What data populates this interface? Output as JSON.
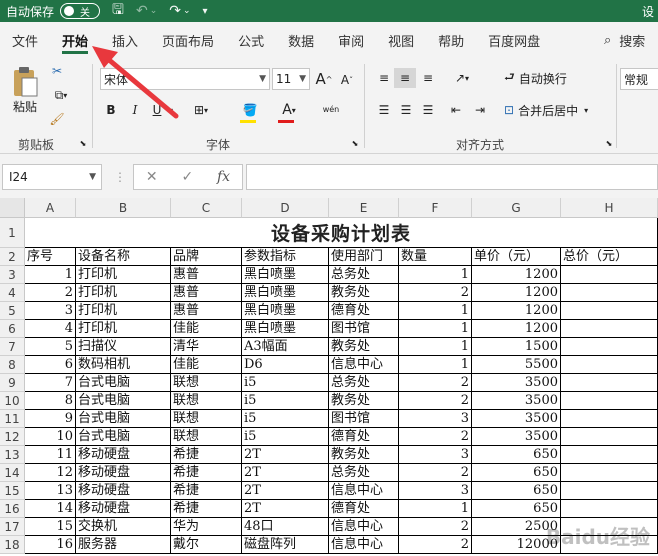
{
  "titlebar": {
    "autosave_label": "自动保存",
    "toggle_state": "关",
    "right_edge_text": "设"
  },
  "tabs": [
    "文件",
    "开始",
    "插入",
    "页面布局",
    "公式",
    "数据",
    "审阅",
    "视图",
    "帮助",
    "百度网盘"
  ],
  "active_tab": "开始",
  "search_label": "搜索",
  "ribbon": {
    "clipboard": {
      "paste_label": "粘贴",
      "group_label": "剪贴板"
    },
    "font": {
      "font_name": "宋体",
      "font_size": "11",
      "group_label": "字体",
      "bold": "B",
      "italic": "I",
      "underline": "U",
      "grow": "A",
      "shrink": "A",
      "font_color_letter": "A",
      "wen": "wén"
    },
    "alignment": {
      "wrap_text": "自动换行",
      "merge_center": "合并后居中",
      "group_label": "对齐方式"
    },
    "number": {
      "format": "常规"
    }
  },
  "formula_bar": {
    "name_box": "I24",
    "fx_label": "fx",
    "cancel": "✕",
    "enter": "✓"
  },
  "sheet": {
    "columns": [
      "A",
      "B",
      "C",
      "D",
      "E",
      "F",
      "G",
      "H"
    ],
    "title": "设备采购计划表",
    "headers": [
      "序号",
      "设备名称",
      "品牌",
      "参数指标",
      "使用部门",
      "数量",
      "单价（元）",
      "总价（元）"
    ],
    "rows": [
      [
        "1",
        "打印机",
        "惠普",
        "黑白喷墨",
        "总务处",
        "1",
        "1200",
        ""
      ],
      [
        "2",
        "打印机",
        "惠普",
        "黑白喷墨",
        "教务处",
        "2",
        "1200",
        ""
      ],
      [
        "3",
        "打印机",
        "惠普",
        "黑白喷墨",
        "德育处",
        "1",
        "1200",
        ""
      ],
      [
        "4",
        "打印机",
        "佳能",
        "黑白喷墨",
        "图书馆",
        "1",
        "1200",
        ""
      ],
      [
        "5",
        "扫描仪",
        "清华",
        "A3幅面",
        "教务处",
        "1",
        "1500",
        ""
      ],
      [
        "6",
        "数码相机",
        "佳能",
        "D6",
        "信息中心",
        "1",
        "5500",
        ""
      ],
      [
        "7",
        "台式电脑",
        "联想",
        "i5",
        "总务处",
        "2",
        "3500",
        ""
      ],
      [
        "8",
        "台式电脑",
        "联想",
        "i5",
        "教务处",
        "2",
        "3500",
        ""
      ],
      [
        "9",
        "台式电脑",
        "联想",
        "i5",
        "图书馆",
        "3",
        "3500",
        ""
      ],
      [
        "10",
        "台式电脑",
        "联想",
        "i5",
        "德育处",
        "2",
        "3500",
        ""
      ],
      [
        "11",
        "移动硬盘",
        "希捷",
        "2T",
        "教务处",
        "3",
        "650",
        ""
      ],
      [
        "12",
        "移动硬盘",
        "希捷",
        "2T",
        "总务处",
        "2",
        "650",
        ""
      ],
      [
        "13",
        "移动硬盘",
        "希捷",
        "2T",
        "信息中心",
        "3",
        "650",
        ""
      ],
      [
        "14",
        "移动硬盘",
        "希捷",
        "2T",
        "德育处",
        "1",
        "650",
        ""
      ],
      [
        "15",
        "交换机",
        "华为",
        "48口",
        "信息中心",
        "2",
        "2500",
        ""
      ],
      [
        "16",
        "服务器",
        "戴尔",
        "磁盘阵列",
        "信息中心",
        "2",
        "12000",
        ""
      ]
    ]
  },
  "watermark": "Baidu经验",
  "colors": {
    "accent": "#217346",
    "arrow": "#e8383d"
  }
}
